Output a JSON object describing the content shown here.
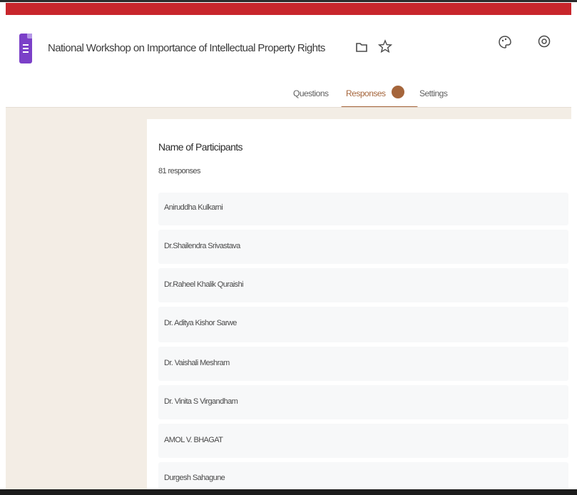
{
  "header": {
    "form_title": "National Workshop on Importance of Intellectual Property Rights"
  },
  "tabs": [
    {
      "label": "Questions",
      "active": false
    },
    {
      "label": "Responses",
      "active": true
    },
    {
      "label": "Settings",
      "active": false
    }
  ],
  "question": {
    "title": "Name of Participants",
    "response_count": "81 responses"
  },
  "responses": [
    "Aniruddha Kulkarni",
    "Dr.Shailendra Srivastava",
    "Dr.Raheel Khalik Quraishi",
    "Dr. Aditya Kishor Sarwe",
    "Dr. Vaishali Meshram",
    "Dr. Vinita S Virgandham",
    "AMOL V. BHAGAT",
    "Durgesh Sahagune"
  ],
  "colors": {
    "accent": "#a5653b",
    "top_band": "#c8262c",
    "forms_icon": "#7b40c8",
    "canvas": "#f3ede5"
  },
  "icons": [
    "forms-app-icon",
    "folder-icon",
    "star-icon",
    "palette-icon",
    "preview-icon"
  ]
}
